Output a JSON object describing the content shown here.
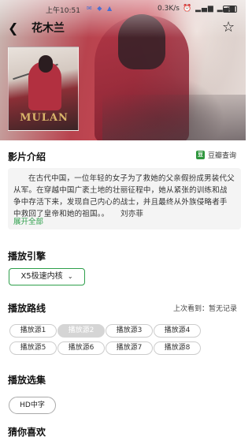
{
  "status_bar": {
    "time": "上午10:51",
    "speed": "0.3K/s",
    "battery": "88"
  },
  "header": {
    "title": "花木兰"
  },
  "poster": {
    "logo_text": "MULAN"
  },
  "intro": {
    "section_title": "影片介绍",
    "douban_icon": "豆",
    "douban_label": "豆瓣查询",
    "text": "在古代中国，一位年轻的女子为了救她的父亲假扮成男装代父从军。在穿越中国广袤土地的壮丽征程中，她从紧张的训练和战争中存活下来，发现自己内心的战士，并且最终从外族侵略者手中救回了皇帝和她的祖国。。　　刘亦菲",
    "expand_label": "展开全部"
  },
  "engine": {
    "section_title": "播放引擎",
    "selected": "X5极速内核"
  },
  "routes": {
    "section_title": "播放路线",
    "last_seen": "上次看到：暂无记录",
    "sources": [
      "播放源1",
      "播放源2",
      "播放源3",
      "播放源4",
      "播放源5",
      "播放源6",
      "播放源7",
      "播放源8"
    ],
    "active_index": 1
  },
  "episodes": {
    "section_title": "播放选集",
    "items": [
      "HD中字"
    ]
  },
  "recommend": {
    "section_title": "猜你喜欢"
  },
  "colors": {
    "accent": "#2e9f4b",
    "douban": "#2e963d"
  }
}
